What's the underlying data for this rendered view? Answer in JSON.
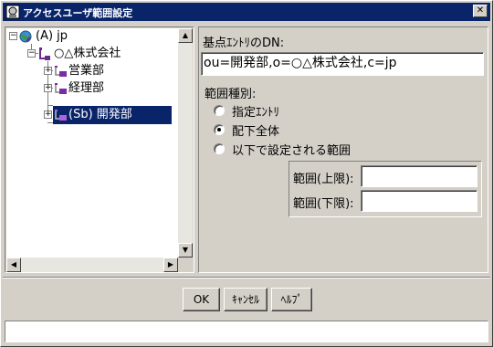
{
  "window": {
    "title": "アクセスユーザ範囲設定",
    "close_label": "✕"
  },
  "tree": {
    "nodes": [
      {
        "label": "(A) jp",
        "expander": "−"
      },
      {
        "label": "○△株式会社",
        "expander": "−"
      },
      {
        "label": "営業部",
        "expander": "+"
      },
      {
        "label": "経理部",
        "expander": "+"
      },
      {
        "label": "(Sb) 開発部",
        "expander": "+",
        "selected": true
      }
    ]
  },
  "scroll": {
    "up": "▲",
    "down": "▼",
    "left": "◀",
    "right": "▶"
  },
  "form": {
    "base_entry_label": "基点ｴﾝﾄﾘのDN:",
    "base_entry_value": "ou=開発部,o=○△株式会社,c=jp",
    "range_type_label": "範囲種別:",
    "options": [
      {
        "label": "指定ｴﾝﾄﾘ",
        "checked": false
      },
      {
        "label": "配下全体",
        "checked": true
      },
      {
        "label": "以下で設定される範囲",
        "checked": false
      }
    ],
    "upper_label": "範囲(上限):",
    "upper_value": "",
    "lower_label": "範囲(下限):",
    "lower_value": ""
  },
  "buttons": {
    "ok": "OK",
    "cancel": "ｷｬﾝｾﾙ",
    "help": "ﾍﾙﾌﾟ"
  },
  "status": {
    "text": ""
  },
  "colors": {
    "titlebar": "#0a246a",
    "selection": "#0a246a",
    "face": "#d4d0c8"
  }
}
